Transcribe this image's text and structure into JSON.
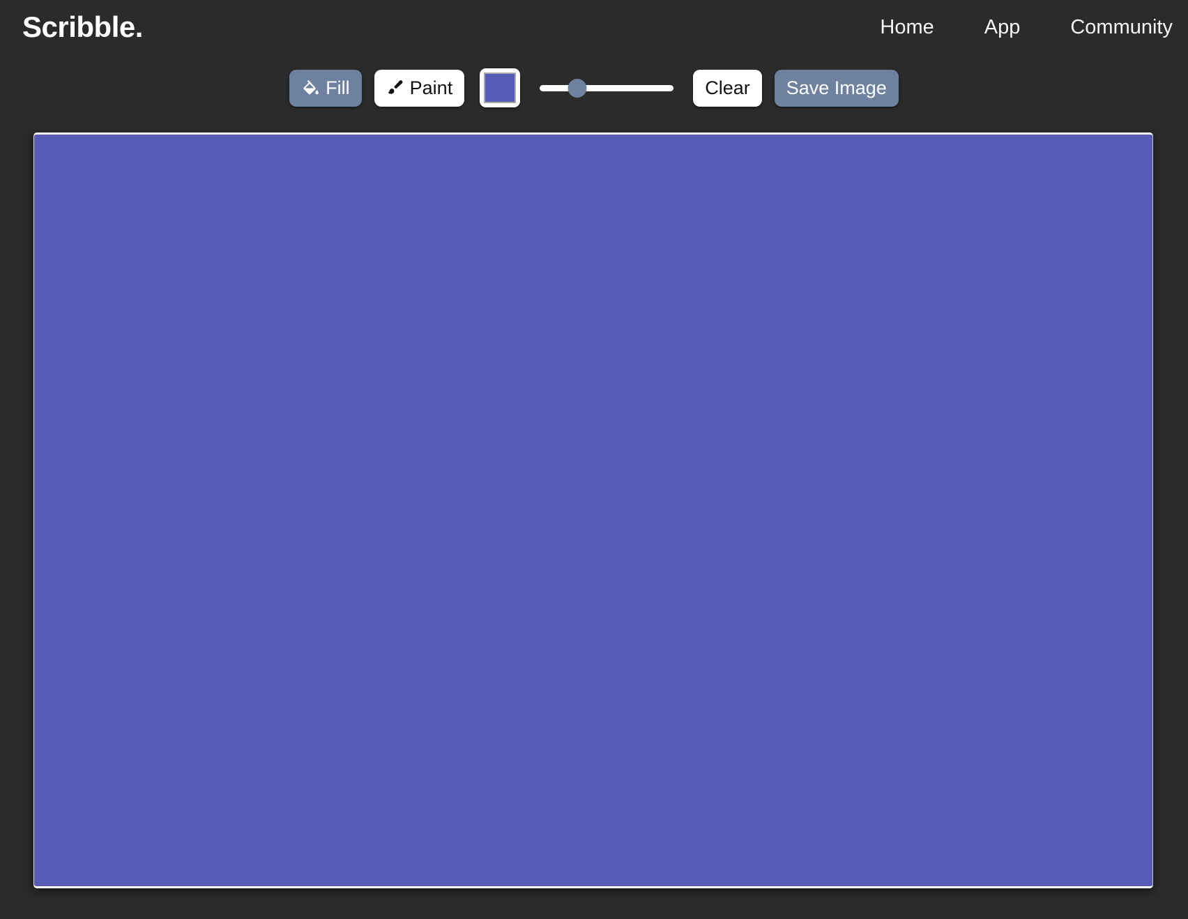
{
  "header": {
    "logo": "Scribble.",
    "nav": [
      {
        "label": "Home",
        "name": "nav-link-home"
      },
      {
        "label": "App",
        "name": "nav-link-app"
      },
      {
        "label": "Community",
        "name": "nav-link-community"
      }
    ]
  },
  "toolbar": {
    "fill_label": "Fill",
    "fill_icon": "paint-bucket-icon",
    "fill_selected": true,
    "paint_label": "Paint",
    "paint_icon": "paint-brush-icon",
    "paint_selected": false,
    "color_swatch": {
      "name": "color-picker-swatch",
      "value": "#565cb5"
    },
    "brush_size_slider": {
      "name": "brush-size-slider",
      "value_percent": 28,
      "min": 0,
      "max": 100,
      "track_color": "#ffffff",
      "thumb_color": "#6e819e"
    },
    "clear_label": "Clear",
    "save_label": "Save Image"
  },
  "canvas": {
    "name": "drawing-canvas",
    "fill_color": "#565cb5"
  },
  "colors": {
    "background": "#2b2b2b",
    "accent": "#6e819e",
    "canvas_fill": "#565cb5",
    "text_light": "#ffffff",
    "text_dark": "#111111"
  }
}
